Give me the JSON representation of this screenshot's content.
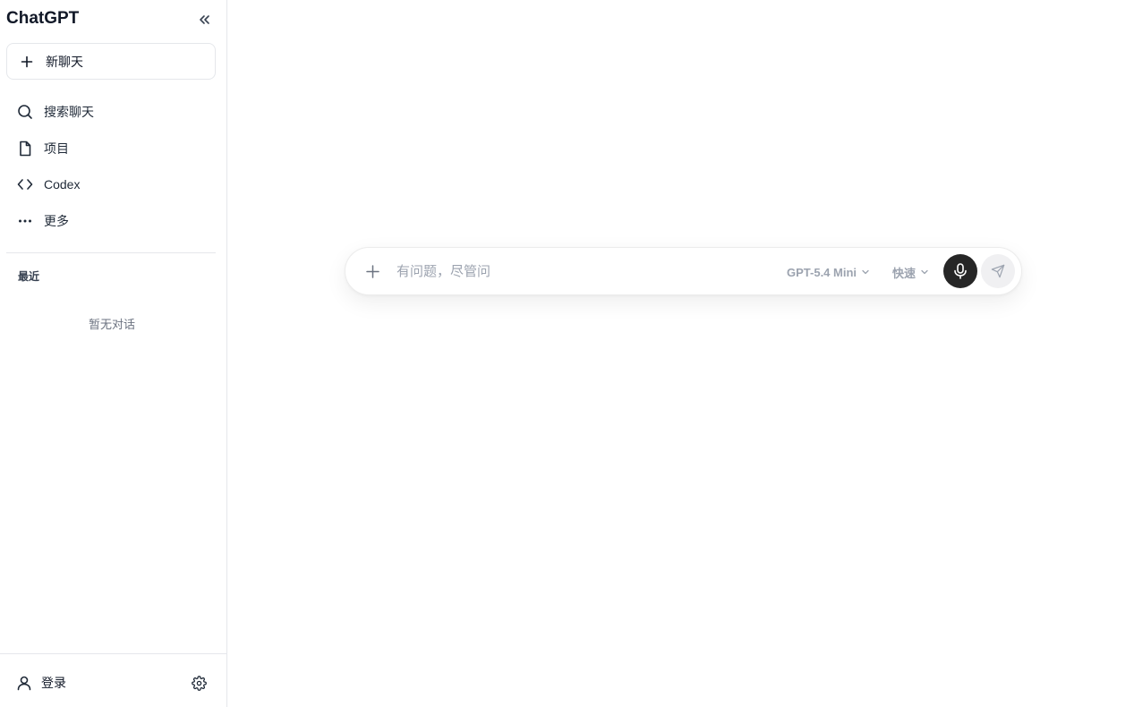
{
  "app": {
    "title": "ChatGPT"
  },
  "sidebar": {
    "collapse_icon": "chevrons-left-icon",
    "new_chat_label": "新聊天",
    "items": [
      {
        "label": "搜索聊天",
        "icon": "search-icon"
      },
      {
        "label": "项目",
        "icon": "file-icon"
      },
      {
        "label": "Codex",
        "icon": "code-icon"
      },
      {
        "label": "更多",
        "icon": "more-horizontal-icon"
      }
    ],
    "recent_title": "最近",
    "empty_text": "暂无对话",
    "footer": {
      "login_label": "登录",
      "login_icon": "user-icon",
      "settings_icon": "gear-icon"
    }
  },
  "composer": {
    "placeholder": "有问题，尽管问",
    "value": "",
    "model": "GPT-5.4 Mini",
    "speed": "快速",
    "mic_icon": "microphone-icon",
    "send_icon": "send-icon",
    "attach_icon": "plus-icon"
  },
  "colors": {
    "border": "#e5e7eb",
    "mic_button_bg": "#262626",
    "send_button_bg": "#f0f0f2",
    "muted_text": "#9ca3af"
  }
}
